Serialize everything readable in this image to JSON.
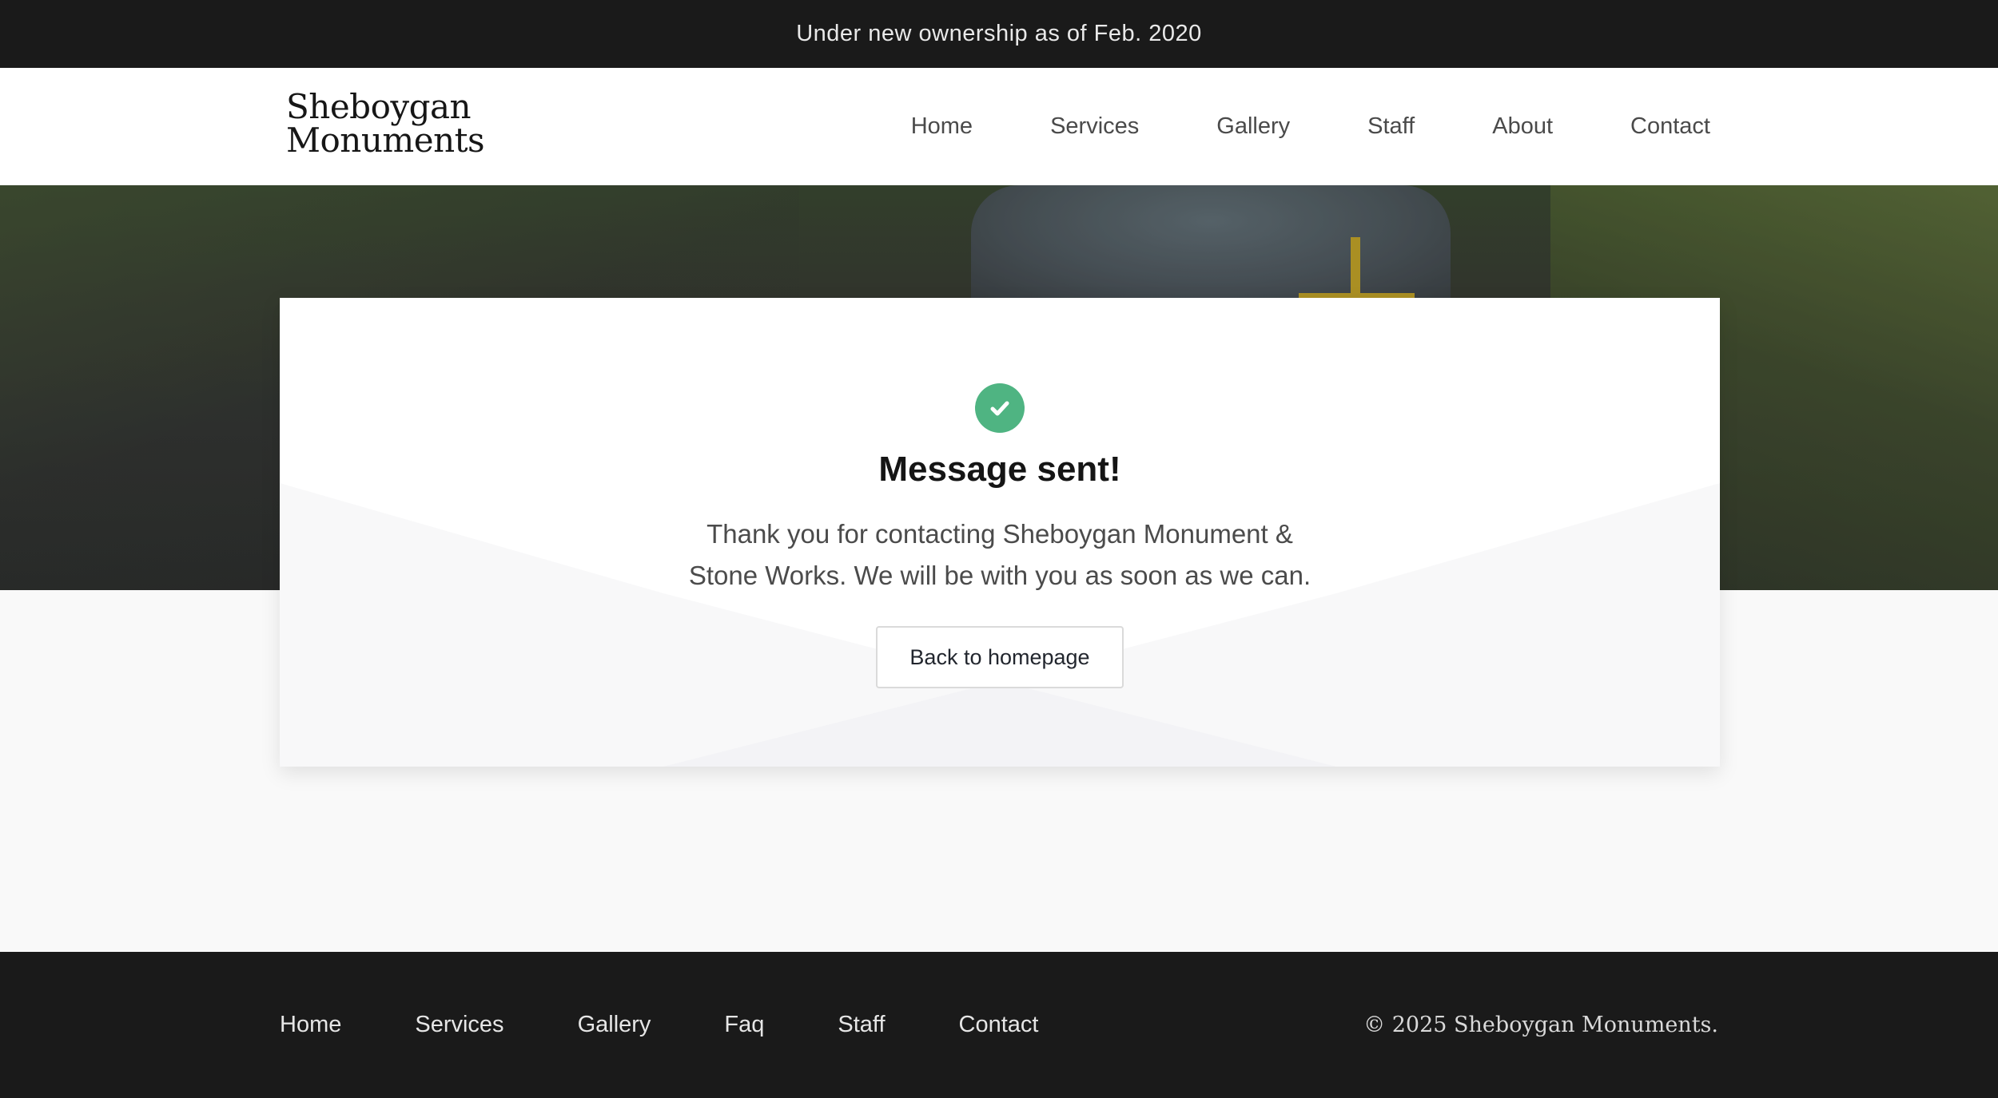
{
  "announcement": "Under new ownership as of Feb. 2020",
  "logo": {
    "line1": "Sheboygan",
    "line2": "Monuments"
  },
  "nav": [
    "Home",
    "Services",
    "Gallery",
    "Staff",
    "About",
    "Contact"
  ],
  "card": {
    "icon": "check-circle-icon",
    "title": "Message sent!",
    "message_line1": "Thank you for contacting Sheboygan Monument &",
    "message_line2": "Stone Works. We will be with you as soon as we can.",
    "button": "Back to homepage"
  },
  "footer": {
    "nav": [
      "Home",
      "Services",
      "Gallery",
      "Faq",
      "Staff",
      "Contact"
    ],
    "copyright": "© 2025 Sheboygan Monuments."
  },
  "colors": {
    "dark_bar": "#1a1a1a",
    "success": "#4fb482",
    "page_bg": "#f9f9f9"
  }
}
